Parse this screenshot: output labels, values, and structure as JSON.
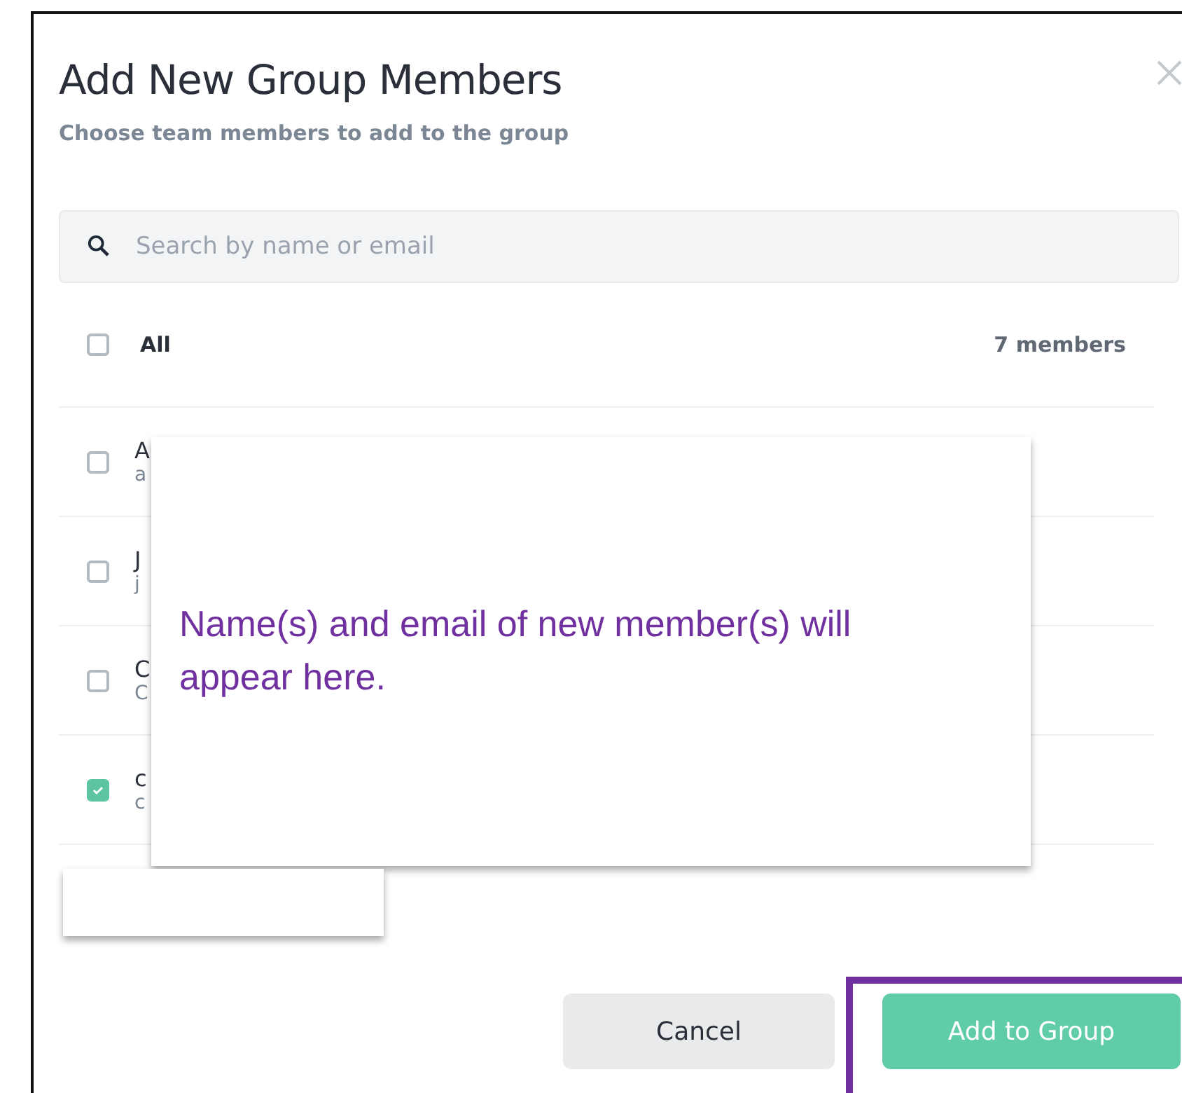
{
  "dialog": {
    "title": "Add New Group Members",
    "subtitle": "Choose team members to add to the group"
  },
  "search": {
    "placeholder": "Search by name or email"
  },
  "select_all": {
    "label": "All",
    "checked": false,
    "count": "7 members"
  },
  "members": [
    {
      "name": "A",
      "email": "a",
      "checked": false
    },
    {
      "name": "J",
      "email": "j",
      "checked": false
    },
    {
      "name": "C",
      "email": "C",
      "checked": false
    },
    {
      "name": "c",
      "email": "c",
      "checked": true
    }
  ],
  "callout": {
    "text": "Name(s) and email of new member(s) will appear here."
  },
  "buttons": [
    {
      "label": "Cancel",
      "kind": "secondary"
    },
    {
      "label": "Add to Group",
      "kind": "primary"
    }
  ]
}
